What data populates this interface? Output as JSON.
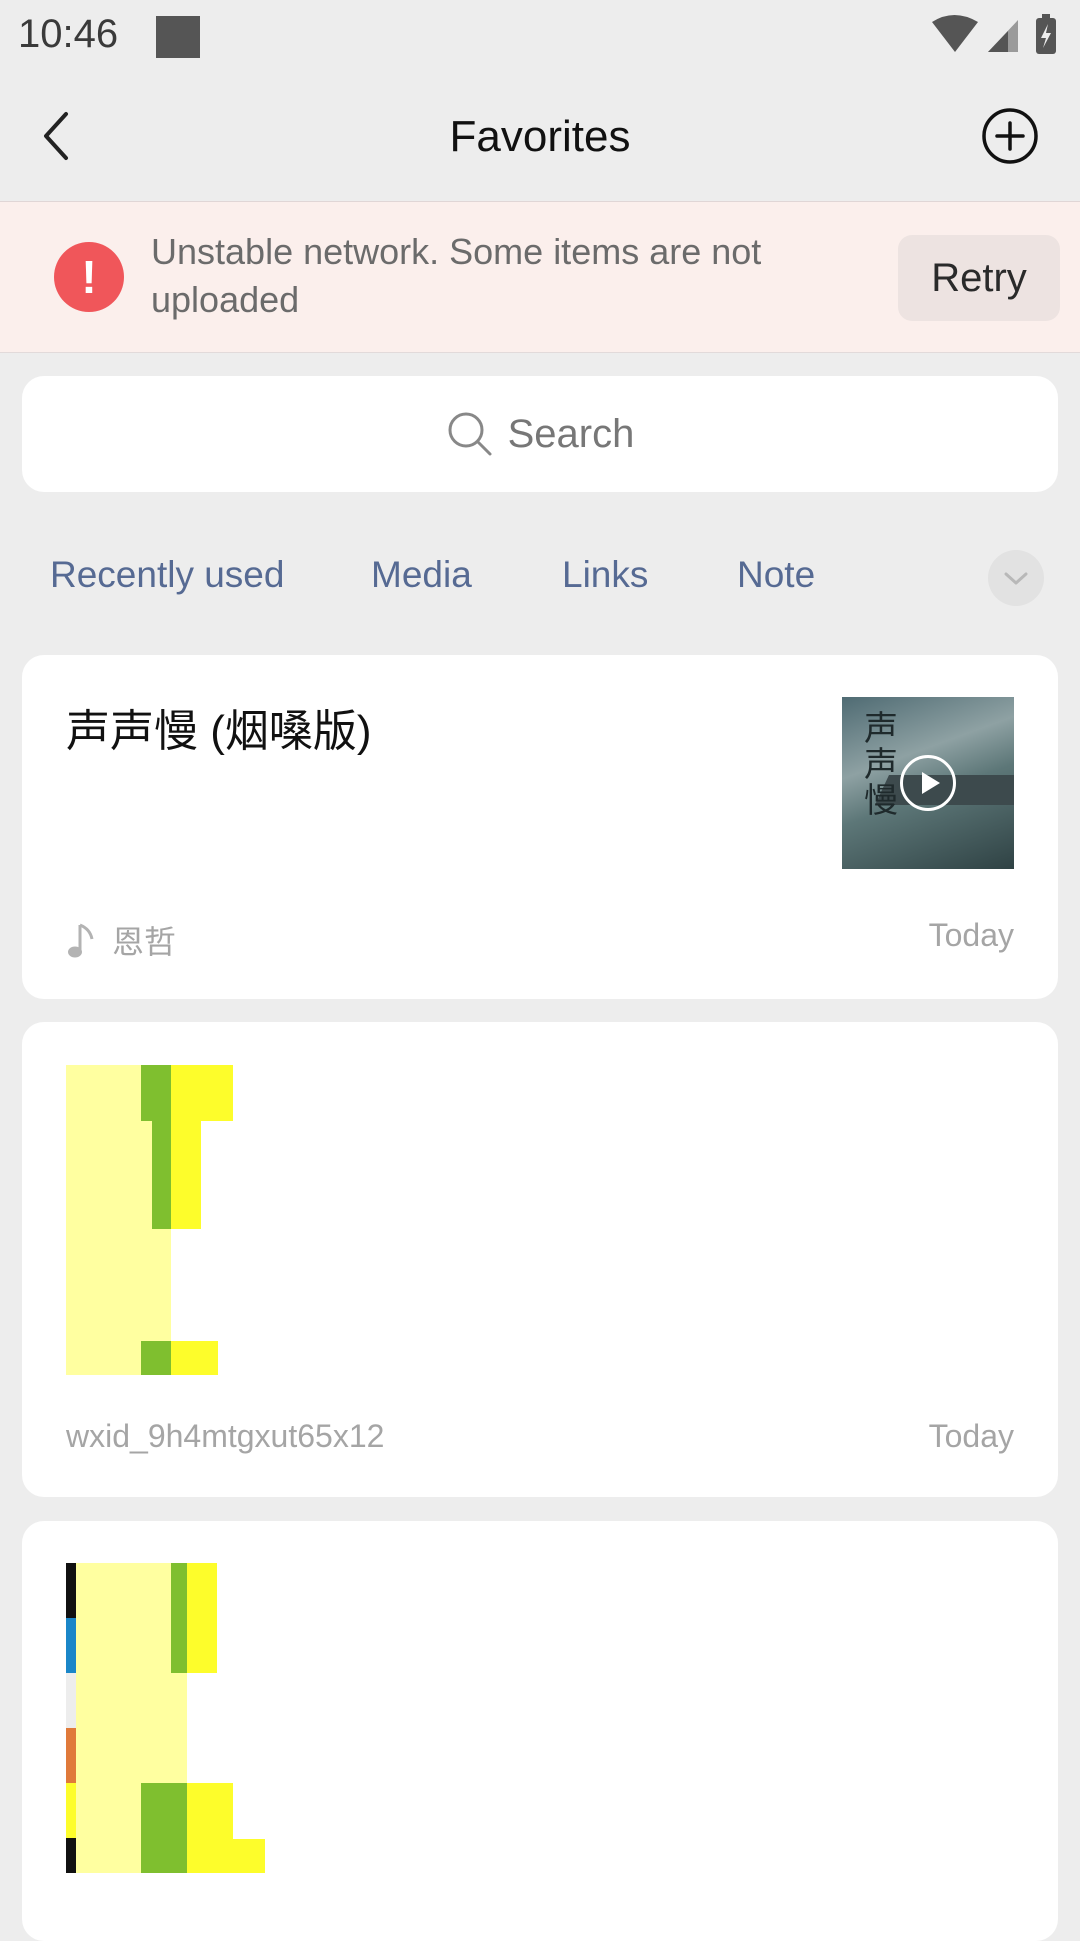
{
  "status_bar": {
    "time": "10:46"
  },
  "header": {
    "title": "Favorites",
    "back_icon": "chevron-left-icon",
    "add_icon": "plus-circle-icon"
  },
  "banner": {
    "message": "Unstable network. Some items are not uploaded",
    "retry_label": "Retry",
    "icon": "alert-icon",
    "accent_color": "#f0565a"
  },
  "search": {
    "placeholder": "Search"
  },
  "tabs": [
    {
      "label": "Recently used"
    },
    {
      "label": "Media"
    },
    {
      "label": "Links"
    },
    {
      "label": "Note"
    }
  ],
  "items": [
    {
      "title": "声声慢 (烟嗓版)",
      "artist": "恩哲",
      "date": "Today",
      "type": "music",
      "thumb_text": "声声慢"
    },
    {
      "source": "wxid_9h4mtgxut65x12",
      "date": "Today",
      "type": "image"
    },
    {
      "type": "image"
    }
  ]
}
